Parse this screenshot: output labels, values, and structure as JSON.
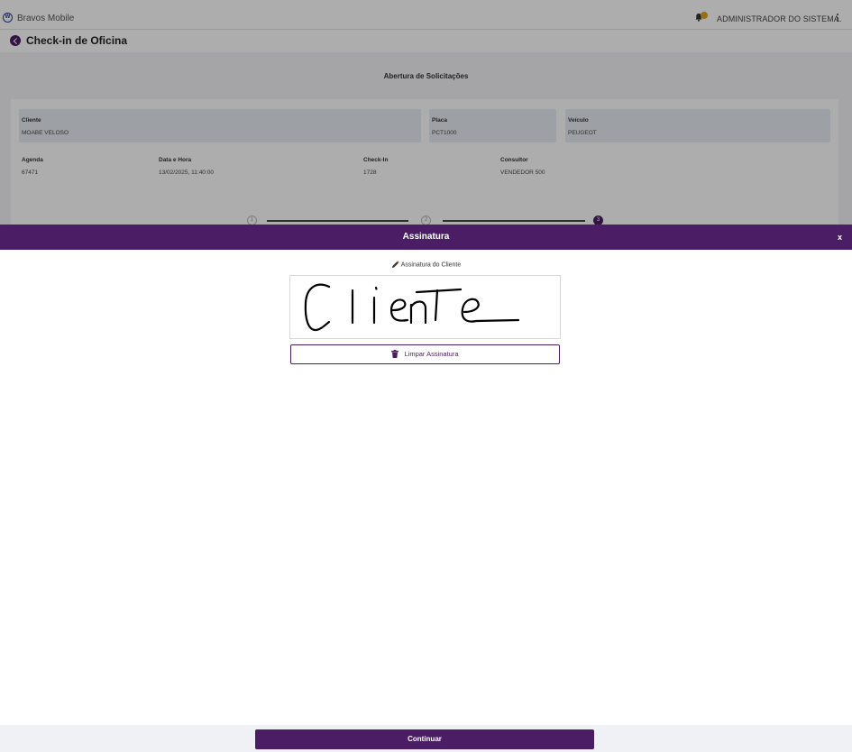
{
  "app": {
    "title": "Bravos Mobile",
    "user": "ADMINISTRADOR DO SISTEMA."
  },
  "page": {
    "title": "Check-in de Oficina"
  },
  "section": {
    "title": "Abertura de Solicitações"
  },
  "fields": {
    "cliente": {
      "label": "Cliente",
      "value": "MOABE VELOSO"
    },
    "placa": {
      "label": "Placa",
      "value": "PCT1000"
    },
    "veiculo": {
      "label": "Veículo",
      "value": "PEUGEOT"
    },
    "agenda": {
      "label": "Agenda",
      "value": "67471"
    },
    "data_hora": {
      "label": "Data e Hora",
      "value": "13/02/2025, 11:40:00"
    },
    "checkin": {
      "label": "Check-In",
      "value": "1728"
    },
    "consultor": {
      "label": "Consultor",
      "value": "VENDEDOR 500"
    }
  },
  "steps": [
    {
      "number": "1",
      "active": false
    },
    {
      "number": "2",
      "active": false
    },
    {
      "number": "3",
      "active": true
    }
  ],
  "modal": {
    "title": "Assinatura",
    "close_label": "x",
    "signature_label": "Assinatura do Cliente",
    "signature_text": "ClienTe",
    "clear_label": "Limpar Assinatura"
  },
  "footer": {
    "continue_label": "Continuar"
  },
  "colors": {
    "primary": "#4a1d64",
    "badge": "#e0a21a"
  },
  "icons": {
    "logo": "brand-logo-icon",
    "bell": "bell-icon",
    "menu": "kebab-menu-icon",
    "back": "back-arrow-icon",
    "pencil": "pencil-icon",
    "trash": "trash-icon"
  }
}
